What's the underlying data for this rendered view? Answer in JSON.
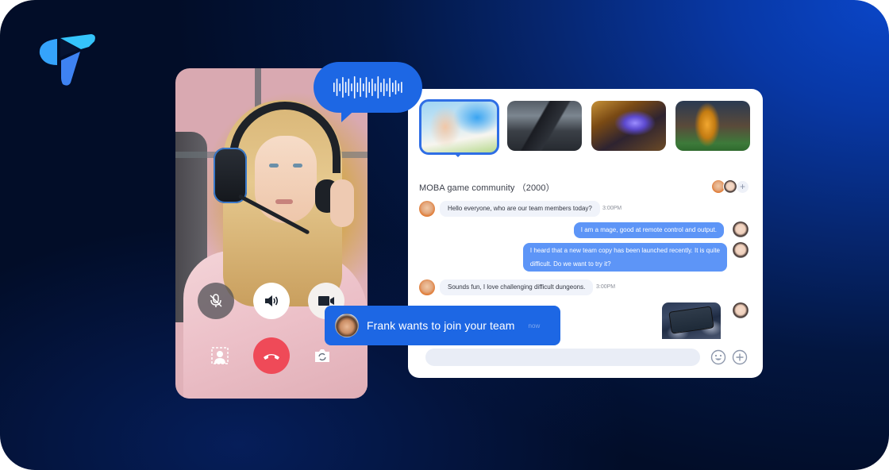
{
  "brand": {
    "logo_icon": "paper-plane-logo-icon",
    "accent": "#1d67e4"
  },
  "video_call": {
    "controls": [
      {
        "name": "mute",
        "icon": "mic-off-icon",
        "state": "muted"
      },
      {
        "name": "speaker",
        "icon": "speaker-icon",
        "state": "on"
      },
      {
        "name": "camera",
        "icon": "video-camera-icon",
        "state": "on"
      },
      {
        "name": "background-blur",
        "icon": "blur-background-icon"
      },
      {
        "name": "hang-up",
        "icon": "phone-hangup-icon",
        "color": "#ef4a58"
      },
      {
        "name": "flip-camera",
        "icon": "flip-camera-icon"
      }
    ]
  },
  "voice_message": {
    "icon": "audio-waveform-icon"
  },
  "chat": {
    "game_thumbnails": [
      {
        "name": "moba",
        "selected": true
      },
      {
        "name": "shooter",
        "selected": false
      },
      {
        "name": "card-strategy",
        "selected": false
      },
      {
        "name": "soccer",
        "selected": false
      }
    ],
    "group_title": "MOBA game community （2000）",
    "add_member_symbol": "+",
    "messages": [
      {
        "direction": "incoming",
        "text": "Hello everyone, who are our team members today?",
        "time": "3:00PM"
      },
      {
        "direction": "outgoing",
        "text": "I am a mage, good at remote control and output."
      },
      {
        "direction": "outgoing",
        "text_line1": "I heard that a new team copy has been launched recently. It is quite",
        "text_line2": "difficult. Do we want to try it?"
      },
      {
        "direction": "incoming",
        "text": "Sounds fun, I love challenging difficult dungeons.",
        "time": "3:00PM"
      },
      {
        "direction": "outgoing",
        "type": "image"
      }
    ],
    "composer": {
      "value": "",
      "placeholder": ""
    },
    "emoji_icon": "emoji-icon",
    "add_icon": "plus-circle-icon"
  },
  "notification": {
    "text": "Frank wants to join your team",
    "time": "now"
  }
}
